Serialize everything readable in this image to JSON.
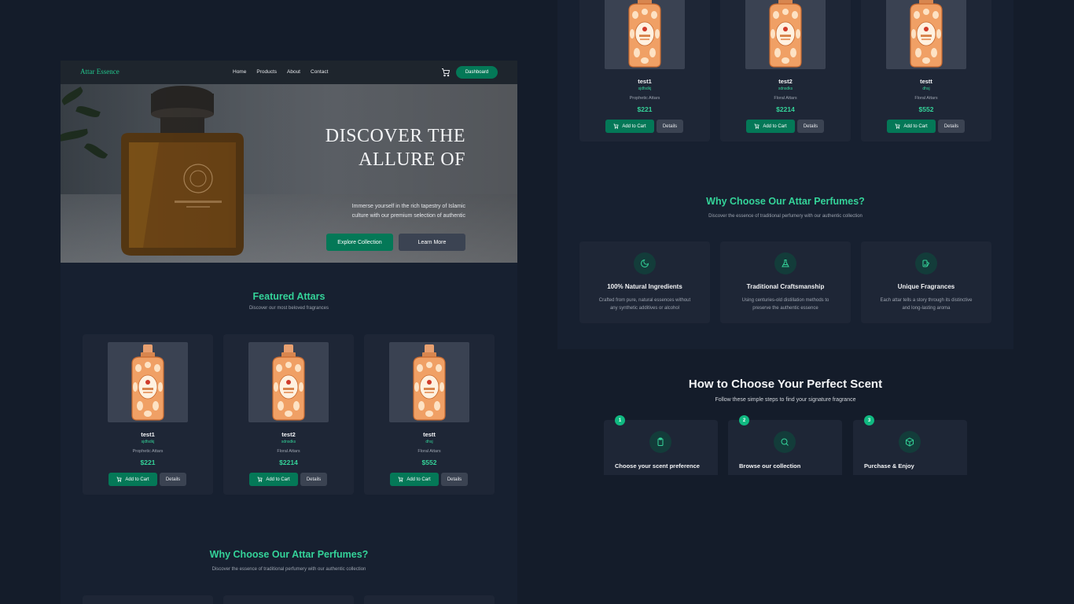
{
  "brand": "Attar Essence",
  "nav": {
    "links": [
      "Home",
      "Products",
      "About",
      "Contact"
    ],
    "dashboard": "Dashboard"
  },
  "hero": {
    "title_line1": "DISCOVER THE",
    "title_line2": "ALLURE OF",
    "desc_line1": "Immerse yourself in the rich tapestry of Islamic",
    "desc_line2": "culture with our premium selection of authentic",
    "explore": "Explore Collection",
    "learn": "Learn More"
  },
  "featured": {
    "title": "Featured Attars",
    "subtitle": "Discover our most beloved fragrances",
    "add_to_cart": "Add to Cart",
    "details": "Details",
    "products": [
      {
        "name": "test1",
        "sub": "sjdfsdkj",
        "category": "Prophetic Attars",
        "price": "$221"
      },
      {
        "name": "test2",
        "sub": "sdnsdks",
        "category": "Floral Attars",
        "price": "$2214"
      },
      {
        "name": "testt",
        "sub": "dhsj",
        "category": "Floral Attars",
        "price": "$552"
      }
    ]
  },
  "why": {
    "title": "Why Choose Our Attar Perfumes?",
    "subtitle": "Discover the essence of traditional perfumery with our authentic collection",
    "features": [
      {
        "title": "100% Natural Ingredients",
        "desc_line1": "Crafted from pure, natural essences without",
        "desc_line2": "any synthetic additives or alcohol",
        "icon": "moon-icon"
      },
      {
        "title": "Traditional Craftsmanship",
        "desc_line1": "Using centuries-old distillation methods to",
        "desc_line2": "preserve the authentic essence",
        "icon": "flask-icon"
      },
      {
        "title": "Unique Fragrances",
        "desc_line1": "Each attar tells a story through its distinctive",
        "desc_line2": "and long-lasting aroma",
        "icon": "palette-icon"
      }
    ]
  },
  "how": {
    "title": "How to Choose Your Perfect Scent",
    "subtitle": "Follow these simple steps to find your signature fragrance",
    "steps": [
      {
        "num": "1",
        "title": "Choose your scent preference",
        "icon": "clipboard-icon"
      },
      {
        "num": "2",
        "title": "Browse our collection",
        "icon": "search-icon"
      },
      {
        "num": "3",
        "title": "Purchase & Enjoy",
        "icon": "box-icon"
      }
    ]
  },
  "colors": {
    "accent": "#34d399",
    "button": "#047857",
    "background": "#141c2a",
    "panel": "#172030",
    "card": "#1e2636"
  }
}
